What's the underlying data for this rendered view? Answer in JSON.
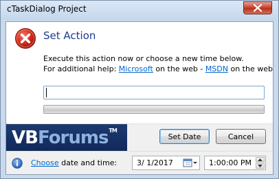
{
  "window": {
    "title": "cTaskDialog Project"
  },
  "dialog": {
    "heading": "Set Action",
    "content_line1": "Execute this action now or choose a new time below.",
    "help_prefix": "For additional help: ",
    "help_link1": "Microsoft",
    "help_middle": " on the web - ",
    "help_link2": "MSDN",
    "help_suffix": " on the web",
    "input_value": "",
    "progress_percent": 0
  },
  "logo": {
    "vb": "VB",
    "forums": "Forums",
    "tm": "TM"
  },
  "buttons": {
    "set_date": "Set Date",
    "cancel": "Cancel"
  },
  "footer": {
    "choose_link": "Choose",
    "label": " date and time:",
    "date_value": "3/  1/2017",
    "time_value": "1:00:00 PM"
  },
  "icons": {
    "error": "error-icon",
    "info": "info-icon",
    "close": "close-icon",
    "calendar": "calendar-dropdown-icon",
    "spin_up": "chevron-up-icon",
    "spin_down": "chevron-down-icon"
  },
  "colors": {
    "heading": "#1e3a8c",
    "link": "#0066cc",
    "close_button": "#c74a35",
    "logo_background": "#12285a"
  }
}
